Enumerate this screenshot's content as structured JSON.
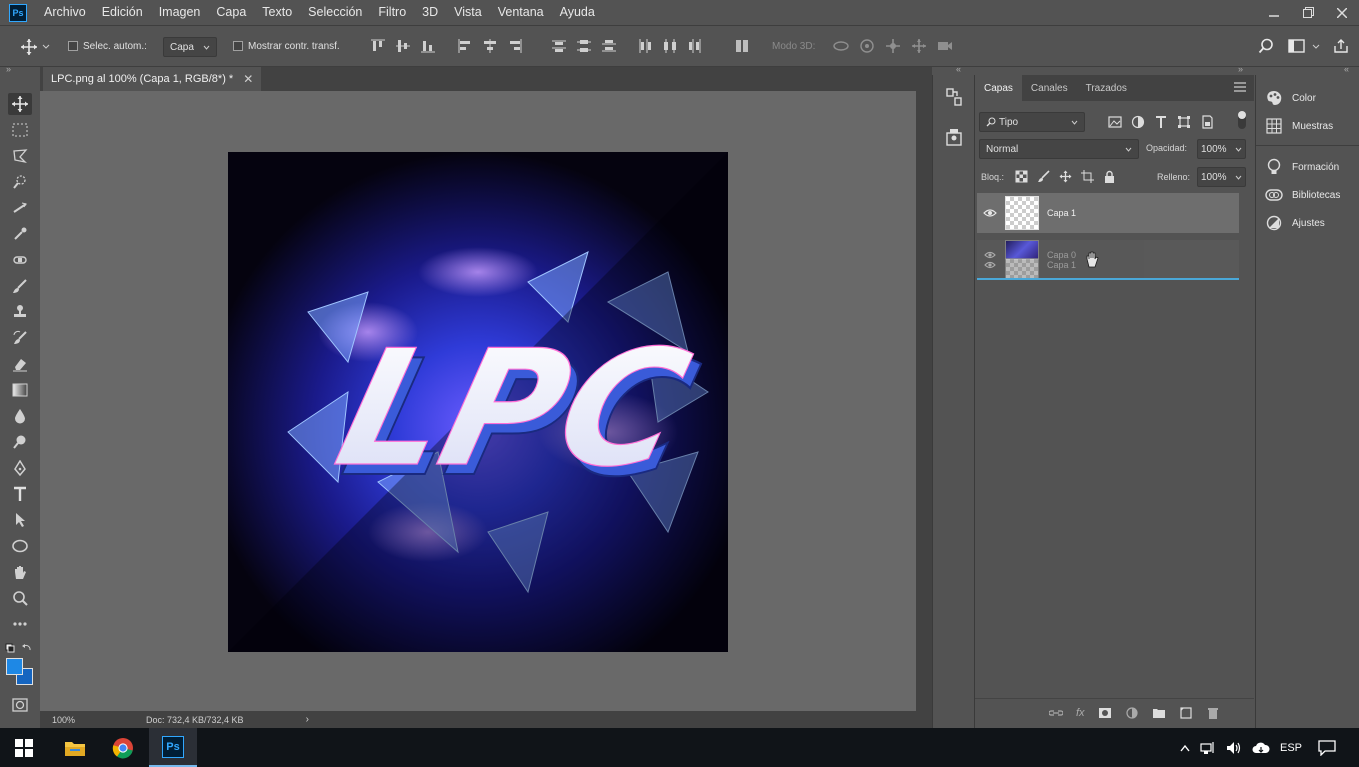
{
  "app": {
    "logo": "Ps"
  },
  "menu": [
    "Archivo",
    "Edición",
    "Imagen",
    "Capa",
    "Texto",
    "Selección",
    "Filtro",
    "3D",
    "Vista",
    "Ventana",
    "Ayuda"
  ],
  "options": {
    "auto_select_label": "Selec. autom.:",
    "auto_select_value": "Capa",
    "show_transform_label": "Mostrar contr. transf.",
    "mode_3d_label": "Modo 3D:"
  },
  "document": {
    "tab_title": "LPC.png al 100% (Capa 1, RGB/8*) *",
    "zoom": "100%",
    "doc_info": "Doc: 732,4 KB/732,4 KB",
    "artwork_text": "LPC"
  },
  "layers_panel": {
    "tabs": [
      "Capas",
      "Canales",
      "Trazados"
    ],
    "filter_value": "Tipo",
    "blend_mode": "Normal",
    "opacity_label": "Opacidad:",
    "opacity_value": "100%",
    "lock_label": "Bloq.:",
    "fill_label": "Relleno:",
    "fill_value": "100%",
    "layers": [
      {
        "name": "Capa 1"
      },
      {
        "name": "Capa 0",
        "sub": "Capa 1"
      }
    ]
  },
  "right_panels": [
    "Color",
    "Muestras",
    "Formación",
    "Bibliotecas",
    "Ajustes"
  ],
  "taskbar": {
    "language": "ESP"
  },
  "colors": {
    "ui_bg": "#535353",
    "canvas_bg": "#696969",
    "accent": "#31a8ff",
    "foreground_swatch": "#1e88e5"
  }
}
